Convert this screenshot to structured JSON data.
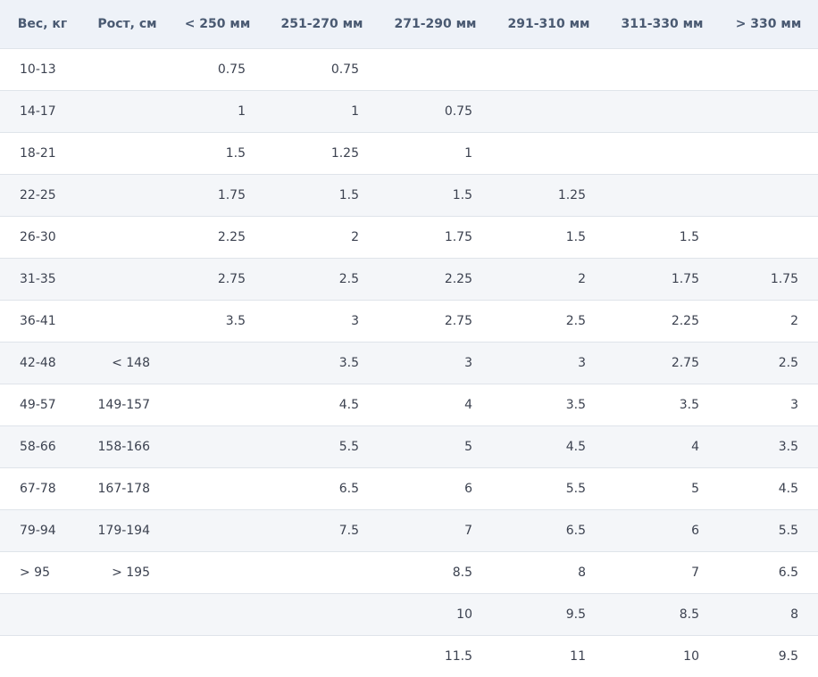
{
  "table": {
    "headers": [
      "Вес, кг",
      "Рост, см",
      "< 250 мм",
      "251-270 мм",
      "271-290 мм",
      "291-310 мм",
      "311-330 мм",
      "> 330 мм"
    ],
    "rows": [
      [
        "10-13",
        "",
        "0.75",
        "0.75",
        "",
        "",
        "",
        ""
      ],
      [
        "14-17",
        "",
        "1",
        "1",
        "0.75",
        "",
        "",
        ""
      ],
      [
        "18-21",
        "",
        "1.5",
        "1.25",
        "1",
        "",
        "",
        ""
      ],
      [
        "22-25",
        "",
        "1.75",
        "1.5",
        "1.5",
        "1.25",
        "",
        ""
      ],
      [
        "26-30",
        "",
        "2.25",
        "2",
        "1.75",
        "1.5",
        "1.5",
        ""
      ],
      [
        "31-35",
        "",
        "2.75",
        "2.5",
        "2.25",
        "2",
        "1.75",
        "1.75"
      ],
      [
        "36-41",
        "",
        "3.5",
        "3",
        "2.75",
        "2.5",
        "2.25",
        "2"
      ],
      [
        "42-48",
        "< 148",
        "",
        "3.5",
        "3",
        "3",
        "2.75",
        "2.5"
      ],
      [
        "49-57",
        "149-157",
        "",
        "4.5",
        "4",
        "3.5",
        "3.5",
        "3"
      ],
      [
        "58-66",
        "158-166",
        "",
        "5.5",
        "5",
        "4.5",
        "4",
        "3.5"
      ],
      [
        "67-78",
        "167-178",
        "",
        "6.5",
        "6",
        "5.5",
        "5",
        "4.5"
      ],
      [
        "79-94",
        "179-194",
        "",
        "7.5",
        "7",
        "6.5",
        "6",
        "5.5"
      ],
      [
        "> 95",
        "> 195",
        "",
        "",
        "8.5",
        "8",
        "7",
        "6.5"
      ],
      [
        "",
        "",
        "",
        "",
        "10",
        "9.5",
        "8.5",
        "8"
      ],
      [
        "",
        "",
        "",
        "",
        "11.5",
        "11",
        "10",
        "9.5"
      ]
    ]
  },
  "colors": {
    "header_bg": "#eef2f8",
    "stripe_bg": "#f4f6f9",
    "header_text": "#4a5a72",
    "body_text": "#3c4250",
    "row_border": "#dfe4ea"
  }
}
